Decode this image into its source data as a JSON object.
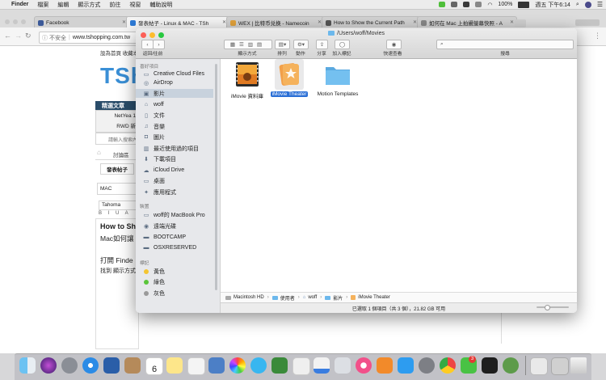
{
  "menubar": {
    "items": [
      "Finder",
      "檔案",
      "編輯",
      "顯示方式",
      "前往",
      "視窗",
      "輔助說明"
    ],
    "battery": "100%",
    "clock": "週五 下午6:14"
  },
  "browser": {
    "tabs": [
      {
        "label": "Facebook",
        "color": "#3b5998"
      },
      {
        "label": "發表帖子 - Linux & MAC - TSh",
        "color": "#2d7ad6"
      },
      {
        "label": "WEX | 比特币兑换 - Namecoin",
        "color": "#e2a23b"
      },
      {
        "label": "How to Show the Current Path",
        "color": "#555555"
      },
      {
        "label": "如何在 Mac 上拍攝螢幕快照 - A",
        "color": "#888888"
      }
    ],
    "url_security": "不安全",
    "url": "www.tshopping.com.tw"
  },
  "webpage": {
    "topnav": "設為首頁  收藏本站",
    "logo": "TSh",
    "box_title": "精選文章",
    "box_lines": [
      "NetYea 1",
      "RWD 新"
    ],
    "search_placeholder": "請輸入搜索內",
    "breadcrumb": "討論區",
    "post_button": "發表帖子",
    "subject": "MAC",
    "font_select": "Tahoma",
    "editor_lines": [
      "How to Sh",
      "Mac如何讓",
      "打開 Finde",
      "找到 顯示方式"
    ]
  },
  "finder": {
    "title": "/Users/woff/Movies",
    "toolbar": {
      "back_forward": "返回/往前",
      "view": "顯示方式",
      "arrange": "排列",
      "action": "動作",
      "share": "分享",
      "tags": "加入標記",
      "quicklook": "快速查看",
      "search": "搜尋"
    },
    "sidebar": {
      "favorites_header": "喜好項目",
      "favorites": [
        {
          "label": "Creative Cloud Files",
          "icon": "folder-icon"
        },
        {
          "label": "AirDrop",
          "icon": "airdrop-icon"
        },
        {
          "label": "影片",
          "icon": "film-icon",
          "selected": true
        },
        {
          "label": "woff",
          "icon": "home-icon"
        },
        {
          "label": "文件",
          "icon": "document-icon"
        },
        {
          "label": "音樂",
          "icon": "music-icon"
        },
        {
          "label": "圖片",
          "icon": "camera-icon"
        },
        {
          "label": "最近使用過的項目",
          "icon": "recents-icon"
        },
        {
          "label": "下載項目",
          "icon": "download-icon"
        },
        {
          "label": "iCloud Drive",
          "icon": "cloud-icon"
        },
        {
          "label": "桌面",
          "icon": "desktop-icon"
        },
        {
          "label": "應用程式",
          "icon": "applications-icon"
        }
      ],
      "devices_header": "裝置",
      "devices": [
        {
          "label": "woff的 MacBook Pro",
          "icon": "laptop-icon"
        },
        {
          "label": "遠端光碟",
          "icon": "disc-icon"
        },
        {
          "label": "BOOTCAMP",
          "icon": "drive-icon"
        },
        {
          "label": "OSXRESERVED",
          "icon": "drive-icon"
        }
      ],
      "tags_header": "標記",
      "tags": [
        {
          "label": "黃色",
          "color": "#f4c531"
        },
        {
          "label": "綠色",
          "color": "#5ac53a"
        },
        {
          "label": "灰色",
          "color": "#9a9a9a"
        }
      ]
    },
    "files": [
      {
        "label": "iMovie 資料庫",
        "icon": "imovie-library-icon",
        "selected": false
      },
      {
        "label": "iMovie Theater",
        "icon": "imovie-theater-icon",
        "selected": true
      },
      {
        "label": "Motion Templates",
        "icon": "folder-icon",
        "selected": false
      }
    ],
    "path": [
      "Macintosh HD",
      "使用者",
      "woff",
      "影片",
      "iMovie Theater"
    ],
    "status": "已選取 1 個項目（共 3 個），21.82 GB 可用"
  },
  "dock": {
    "calendar_day": "6",
    "badge": "3"
  },
  "colors": {
    "selection_blue": "#2a6fd6",
    "sidebar_selected": "#c8d2dd",
    "folder_blue": "#6cb8ec"
  }
}
